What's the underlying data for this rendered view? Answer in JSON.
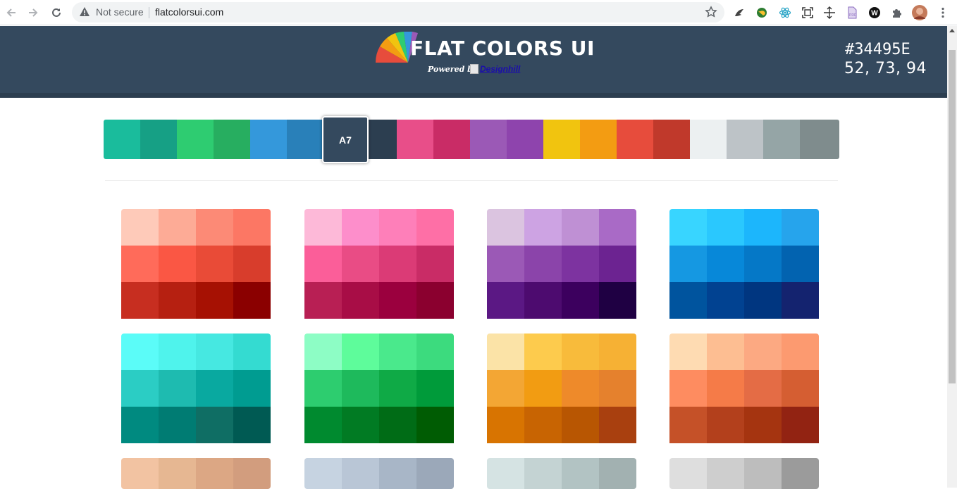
{
  "browser": {
    "not_secure": "Not secure",
    "url": "flatcolorsui.com"
  },
  "header": {
    "logo_word1": "Flat",
    "logo_word2": "Colors UI",
    "powered_by": "Powered by",
    "sponsor_link": "Designhill",
    "hex_value": "#34495E",
    "rgb_value": "52, 73, 94"
  },
  "strip": {
    "selected_label": "A7",
    "selected_index": 6,
    "colors": [
      "#1abc9c",
      "#16a085",
      "#2ecc71",
      "#27ae60",
      "#3498db",
      "#2980b9",
      "#34495e",
      "#2c3e50",
      "#e84e89",
      "#c92c66",
      "#9b59b6",
      "#8e44ad",
      "#f1c40f",
      "#f39c12",
      "#e74c3c",
      "#c0392b",
      "#ecf0f1",
      "#bdc3c7",
      "#95a5a6",
      "#7f8c8d"
    ]
  },
  "palettes": [
    {
      "colors": [
        "#fecab9",
        "#fdab96",
        "#fc8a76",
        "#fc7764",
        "#ff6b5a",
        "#fa5744",
        "#e94b37",
        "#d83d2c",
        "#c72e20",
        "#b62011",
        "#a61103",
        "#8b0000"
      ]
    },
    {
      "colors": [
        "#fdb9d8",
        "#fd8ecb",
        "#fe7fb9",
        "#fe6fa6",
        "#fb5e99",
        "#e94c85",
        "#db3b76",
        "#c92c66",
        "#b81f54",
        "#a80d46",
        "#9b003e",
        "#8b002f"
      ]
    },
    {
      "colors": [
        "#dbc4e0",
        "#cda3e3",
        "#bf90d4",
        "#a96ac6",
        "#9b59b6",
        "#8b44aa",
        "#7d33a0",
        "#6c2391",
        "#5b1884",
        "#4d0b6f",
        "#3c005e",
        "#1f0043"
      ]
    },
    {
      "colors": [
        "#38d5ff",
        "#2ac8fe",
        "#1cb6fc",
        "#26a4ec",
        "#1598e2",
        "#0788d9",
        "#0578c7",
        "#0263b0",
        "#00549e",
        "#014291",
        "#003680",
        "#14236f"
      ]
    },
    {
      "colors": [
        "#5bfcf8",
        "#4ff3ec",
        "#46e8e1",
        "#34dbd1",
        "#2bcdc4",
        "#1ebbb0",
        "#09a9a0",
        "#009c91",
        "#008a80",
        "#007c73",
        "#0f6e64",
        "#005a53"
      ]
    },
    {
      "colors": [
        "#8dfdc5",
        "#5efc9b",
        "#4ae98c",
        "#3cdb7e",
        "#2dcd6f",
        "#1eba5c",
        "#0faa46",
        "#009b3a",
        "#008a2f",
        "#017b23",
        "#006c16",
        "#005c03"
      ]
    },
    {
      "colors": [
        "#fbe3a7",
        "#fdcb4d",
        "#f8bb3b",
        "#f6b134",
        "#f3a634",
        "#f29c12",
        "#ee8a2a",
        "#e5812d",
        "#d87401",
        "#c86402",
        "#b85602",
        "#a9400f"
      ]
    },
    {
      "colors": [
        "#fedbb2",
        "#fdbe92",
        "#fca982",
        "#fc9a70",
        "#fe8c60",
        "#f57b48",
        "#e46c45",
        "#d55e32",
        "#c55128",
        "#b3401c",
        "#a53410",
        "#922312"
      ]
    },
    {
      "colors": [
        "#f2c3a2",
        "#e6b792",
        "#dca784",
        "#d29d7e"
      ]
    },
    {
      "colors": [
        "#c6d3e1",
        "#b9c6d6",
        "#a8b6c7",
        "#9ba8b9"
      ]
    },
    {
      "colors": [
        "#d5e3e3",
        "#c4d3d3",
        "#b2c3c3",
        "#a2b1b1"
      ]
    },
    {
      "colors": [
        "#dedede",
        "#cecece",
        "#bdbdbd",
        "#9b9b9b"
      ]
    }
  ]
}
